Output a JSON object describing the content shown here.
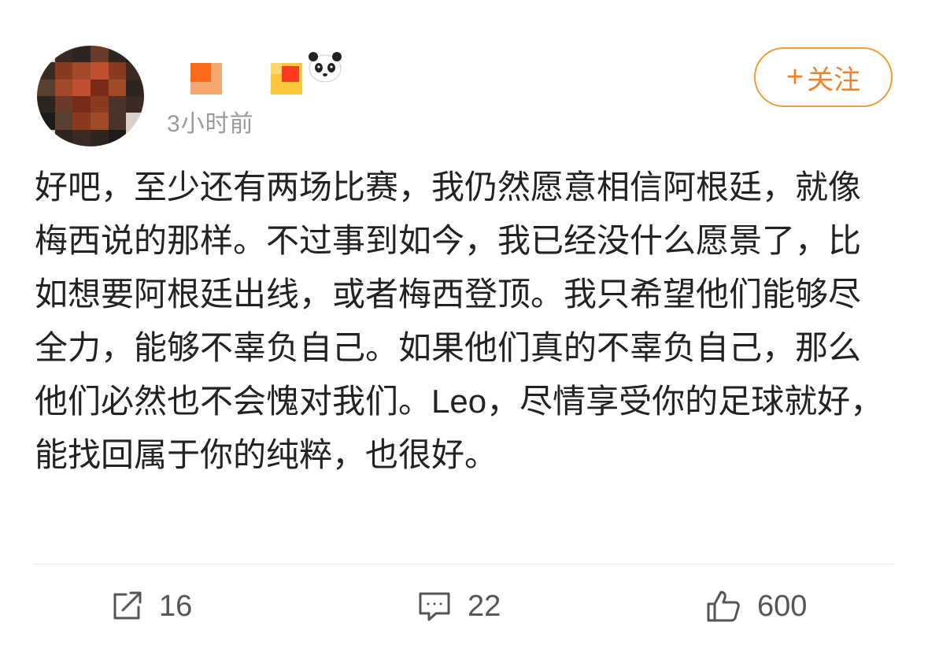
{
  "post": {
    "author": {
      "avatar_colors": [
        "#3a2a22",
        "#6b3a28",
        "#8a3a20",
        "#a04a2a",
        "#5a4030",
        "#2f2520",
        "#c05030",
        "#7a2a18",
        "#4a3328",
        "#9a6a4a",
        "#d8cfc8",
        "#1e1a18"
      ]
    },
    "timestamp": "3小时前",
    "follow_label": "关注",
    "follow_plus": "+",
    "content": "好吧，至少还有两场比赛，我仍然愿意相信阿根廷，就像梅西说的那样。不过事到如今，我已经没什么愿景了，比如想要阿根廷出线，或者梅西登顶。我只希望他们能够尽全力，能够不辜负自己。如果他们真的不辜负自己，那么他们必然也不会愧对我们。Leo，尽情享受你的足球就好，能找回属于你的纯粹，也很好。"
  },
  "actions": {
    "repost_count": "16",
    "comment_count": "22",
    "like_count": "600"
  },
  "colors": {
    "accent": "#f0822b",
    "text": "#222222",
    "muted": "#9a9a9a"
  }
}
